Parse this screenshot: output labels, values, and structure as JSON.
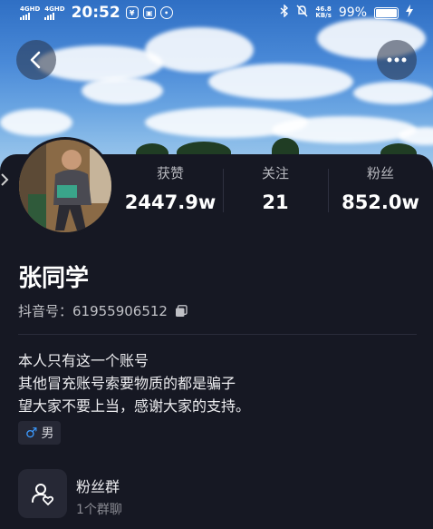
{
  "status_bar": {
    "sim1": "4GHD",
    "sim2": "4GHD",
    "time": "20:52",
    "net_speed_value": "46.8",
    "net_speed_unit": "KB/s",
    "battery": "99%"
  },
  "profile": {
    "stats": [
      {
        "label": "获赞",
        "value": "2447.9w"
      },
      {
        "label": "关注",
        "value": "21"
      },
      {
        "label": "粉丝",
        "value": "852.0w"
      }
    ],
    "name": "张同学",
    "id_line": "抖音号：61955906512",
    "bio_lines": [
      "本人只有这一个账号",
      "其他冒充账号索要物质的都是骗子",
      "望大家不要上当，感谢大家的支持。"
    ],
    "gender_symbol": "♂",
    "gender_label": "男"
  },
  "fan_group": {
    "title": "粉丝群",
    "subtitle": "1个群聊"
  },
  "colors": {
    "background": "#161823",
    "gender_accent": "#3c9aff"
  }
}
